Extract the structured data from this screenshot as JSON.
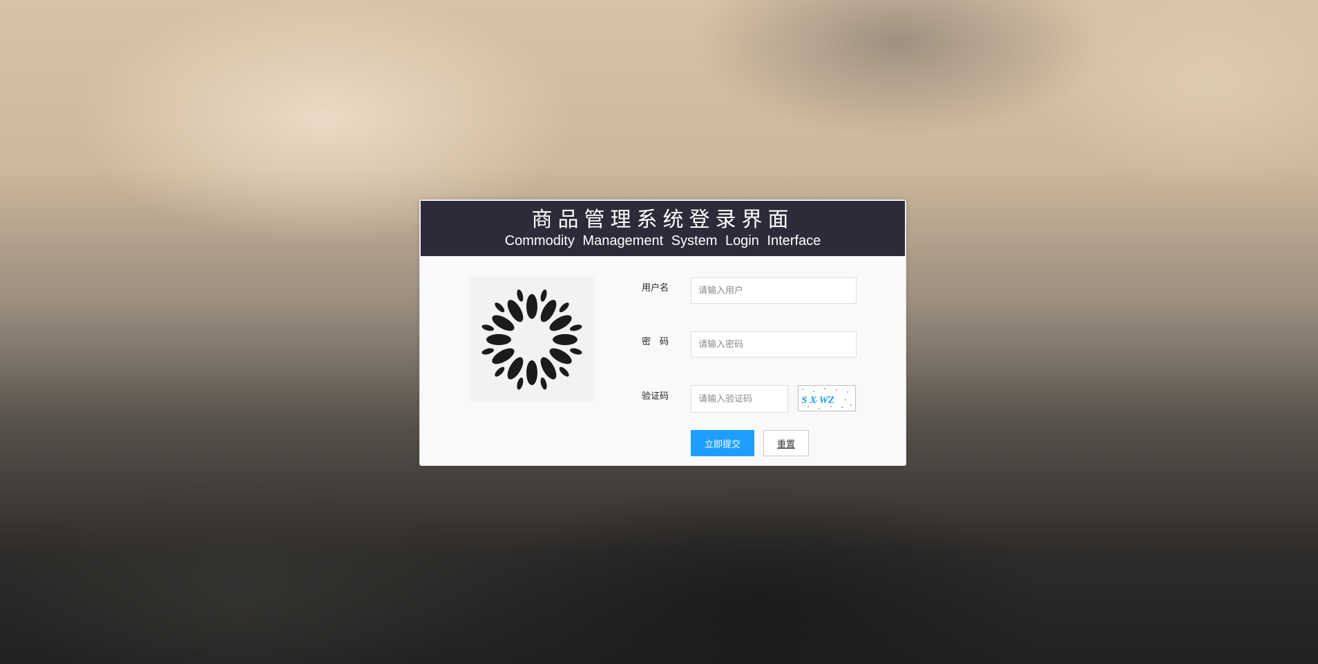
{
  "header": {
    "title_cn": "商品管理系统登录界面",
    "title_en": "Commodity Management System Login Interface"
  },
  "logo": {
    "icon": "flower-logo-icon"
  },
  "form": {
    "username": {
      "label": "用户名",
      "placeholder": "请输入用户",
      "value": ""
    },
    "password": {
      "label": "密　码",
      "placeholder": "请输入密码",
      "value": ""
    },
    "captcha": {
      "label": "验证码",
      "placeholder": "请输入验证码",
      "value": "",
      "image_text": "S X WZ"
    },
    "submit_label": "立即提交",
    "reset_label": "重置"
  },
  "colors": {
    "header_bg": "#2d2b3a",
    "primary": "#1e9fff",
    "captcha_text": "#1e9fff"
  }
}
